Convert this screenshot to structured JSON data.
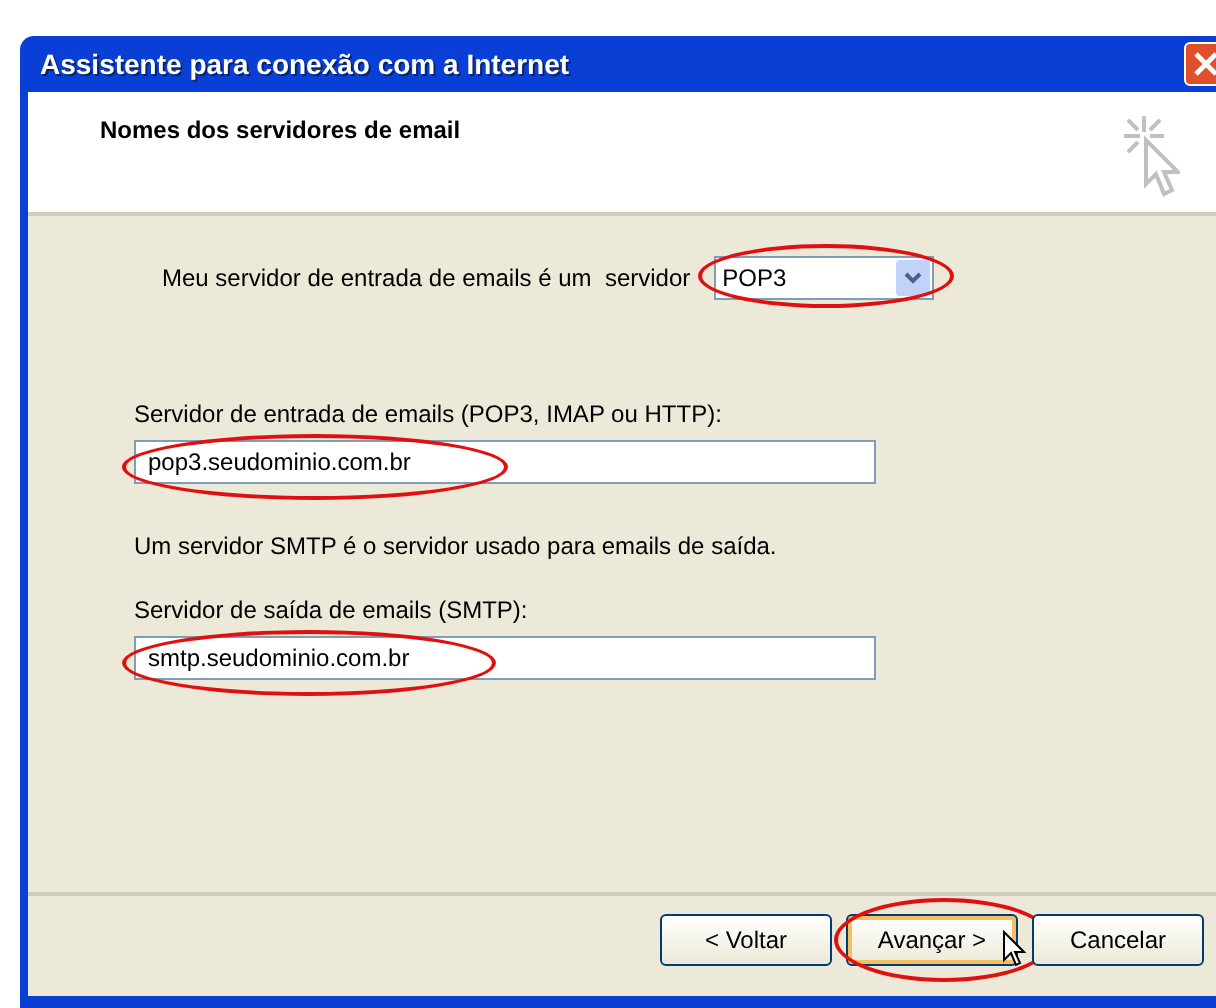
{
  "window": {
    "title": "Assistente para conexão com a Internet"
  },
  "header": {
    "title": "Nomes dos servidores de email"
  },
  "server_type": {
    "label": "Meu servidor de entrada de emails é um  servidor",
    "value": "POP3",
    "circled": true
  },
  "incoming": {
    "label": "Servidor de entrada de emails (POP3, IMAP ou HTTP):",
    "value": "pop3.seudominio.com.br",
    "circled": true
  },
  "smtp_note": "Um servidor SMTP é o servidor usado para emails de saída.",
  "outgoing": {
    "label": "Servidor de saída de emails (SMTP):",
    "value": "smtp.seudominio.com.br",
    "circled": true
  },
  "buttons": [
    {
      "label": "< Voltar",
      "default": false,
      "circled": false
    },
    {
      "label": "Avançar >",
      "default": true,
      "circled": true
    },
    {
      "label": "Cancelar",
      "default": false,
      "circled": false
    }
  ]
}
